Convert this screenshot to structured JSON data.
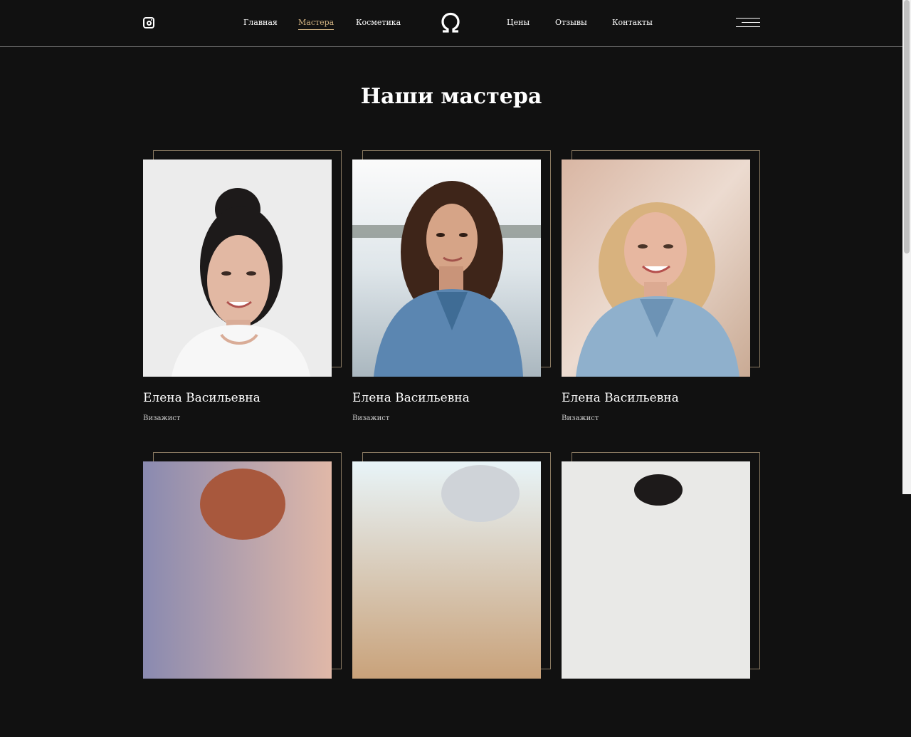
{
  "nav": {
    "left": [
      "Главная",
      "Мастера",
      "Косметика"
    ],
    "right": [
      "Цены",
      "Отзывы",
      "Контакты"
    ],
    "active": "Мастера"
  },
  "icons": {
    "social": "instagram-icon",
    "logo": "omega-logo-icon",
    "menu": "hamburger-menu-icon"
  },
  "colors": {
    "background": "#111111",
    "accent": "#d3b483",
    "frame": "#8a7a62",
    "divider": "#6a6a6a"
  },
  "section": {
    "title": "Наши мастера"
  },
  "masters": [
    {
      "name": "Елена Васильевна",
      "role": "Визажист"
    },
    {
      "name": "Елена Васильевна",
      "role": "Визажист"
    },
    {
      "name": "Елена Васильевна",
      "role": "Визажист"
    }
  ]
}
